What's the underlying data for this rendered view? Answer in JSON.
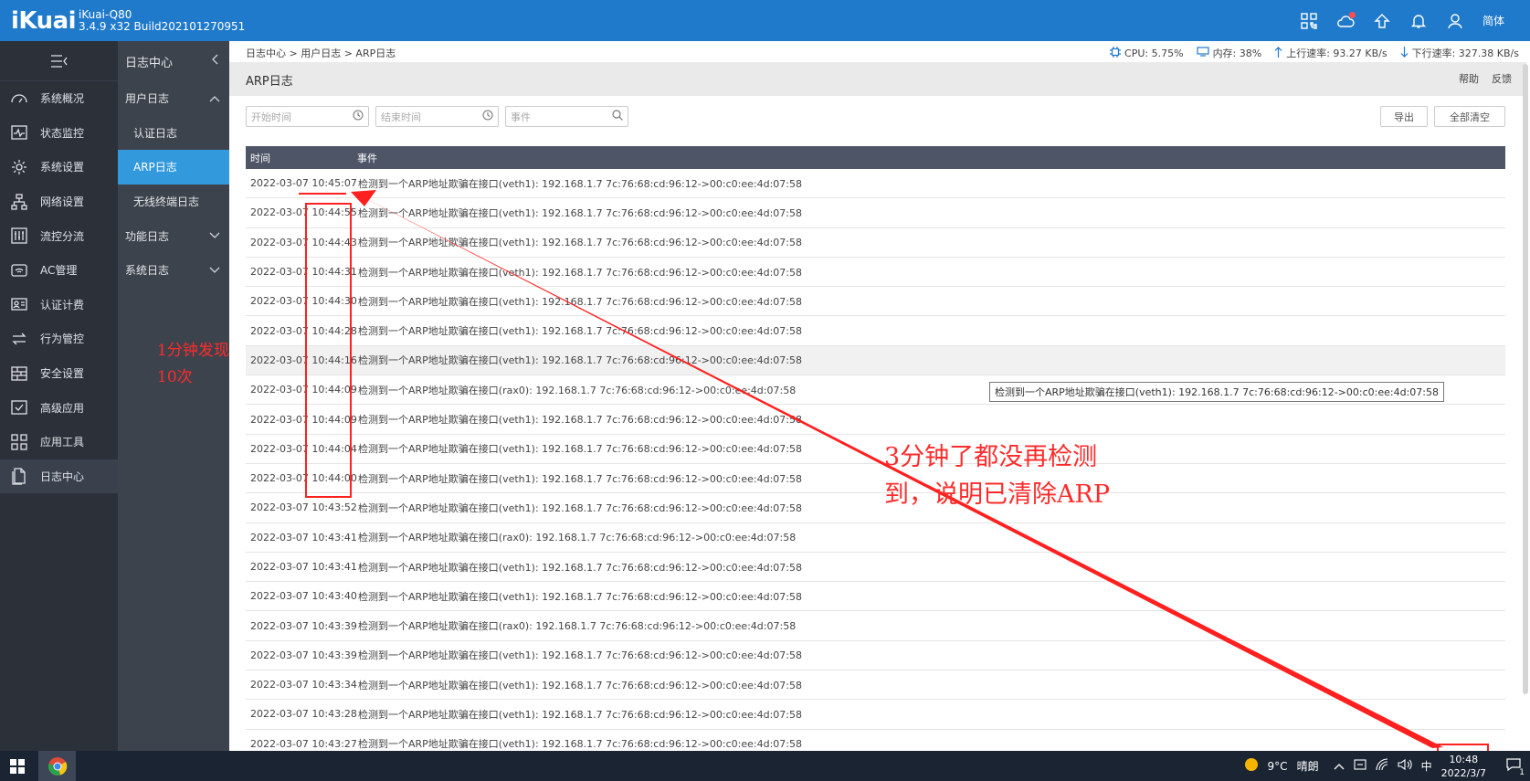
{
  "header": {
    "logo": "iKuai",
    "model": "iKuai-Q80",
    "build": "3.4.9 x32 Build202101270951",
    "lang": "简体"
  },
  "sidebar": {
    "items": [
      {
        "label": "系统概况",
        "icon": "dashboard-icon"
      },
      {
        "label": "状态监控",
        "icon": "monitor-icon"
      },
      {
        "label": "系统设置",
        "icon": "gear-icon"
      },
      {
        "label": "网络设置",
        "icon": "network-icon"
      },
      {
        "label": "流控分流",
        "icon": "sliders-icon"
      },
      {
        "label": "AC管理",
        "icon": "wifi-icon"
      },
      {
        "label": "认证计费",
        "icon": "id-card-icon"
      },
      {
        "label": "行为管控",
        "icon": "arrows-icon"
      },
      {
        "label": "安全设置",
        "icon": "firewall-icon"
      },
      {
        "label": "高级应用",
        "icon": "check-box-icon"
      },
      {
        "label": "应用工具",
        "icon": "apps-icon"
      },
      {
        "label": "日志中心",
        "icon": "document-icon"
      }
    ]
  },
  "subnav": {
    "title": "日志中心",
    "items": [
      {
        "label": "用户日志"
      },
      {
        "label": "认证日志"
      },
      {
        "label": "ARP日志"
      },
      {
        "label": "无线终端日志"
      },
      {
        "label": "功能日志"
      },
      {
        "label": "系统日志"
      }
    ]
  },
  "breadcrumb": "日志中心 > 用户日志 > ARP日志",
  "stats": {
    "cpu": "CPU: 5.75%",
    "mem": "内存: 38%",
    "up": "上行速率: 93.27 KB/s",
    "down": "下行速率: 327.38 KB/s"
  },
  "page": {
    "title": "ARP日志",
    "help": "帮助",
    "feedback": "反馈"
  },
  "filters": {
    "start_placeholder": "开始时间",
    "end_placeholder": "结束时间",
    "event_placeholder": "事件",
    "export": "导出",
    "clear_all": "全部清空"
  },
  "table": {
    "col_time": "时间",
    "col_event": "事件",
    "rows": [
      {
        "time": "2022-03-07 10:45:07",
        "event": "检测到一个ARP地址欺骗在接口(veth1): 192.168.1.7 7c:76:68:cd:96:12->00:c0:ee:4d:07:58"
      },
      {
        "time": "2022-03-07 10:44:55",
        "event": "检测到一个ARP地址欺骗在接口(veth1): 192.168.1.7 7c:76:68:cd:96:12->00:c0:ee:4d:07:58"
      },
      {
        "time": "2022-03-07 10:44:43",
        "event": "检测到一个ARP地址欺骗在接口(veth1): 192.168.1.7 7c:76:68:cd:96:12->00:c0:ee:4d:07:58"
      },
      {
        "time": "2022-03-07 10:44:31",
        "event": "检测到一个ARP地址欺骗在接口(veth1): 192.168.1.7 7c:76:68:cd:96:12->00:c0:ee:4d:07:58"
      },
      {
        "time": "2022-03-07 10:44:30",
        "event": "检测到一个ARP地址欺骗在接口(veth1): 192.168.1.7 7c:76:68:cd:96:12->00:c0:ee:4d:07:58"
      },
      {
        "time": "2022-03-07 10:44:28",
        "event": "检测到一个ARP地址欺骗在接口(veth1): 192.168.1.7 7c:76:68:cd:96:12->00:c0:ee:4d:07:58"
      },
      {
        "time": "2022-03-07 10:44:16",
        "event": "检测到一个ARP地址欺骗在接口(veth1): 192.168.1.7 7c:76:68:cd:96:12->00:c0:ee:4d:07:58"
      },
      {
        "time": "2022-03-07 10:44:09",
        "event": "检测到一个ARP地址欺骗在接口(rax0): 192.168.1.7 7c:76:68:cd:96:12->00:c0:ee:4d:07:58"
      },
      {
        "time": "2022-03-07 10:44:09",
        "event": "检测到一个ARP地址欺骗在接口(veth1): 192.168.1.7 7c:76:68:cd:96:12->00:c0:ee:4d:07:58"
      },
      {
        "time": "2022-03-07 10:44:04",
        "event": "检测到一个ARP地址欺骗在接口(veth1): 192.168.1.7 7c:76:68:cd:96:12->00:c0:ee:4d:07:58"
      },
      {
        "time": "2022-03-07 10:44:00",
        "event": "检测到一个ARP地址欺骗在接口(veth1): 192.168.1.7 7c:76:68:cd:96:12->00:c0:ee:4d:07:58"
      },
      {
        "time": "2022-03-07 10:43:52",
        "event": "检测到一个ARP地址欺骗在接口(veth1): 192.168.1.7 7c:76:68:cd:96:12->00:c0:ee:4d:07:58"
      },
      {
        "time": "2022-03-07 10:43:41",
        "event": "检测到一个ARP地址欺骗在接口(rax0): 192.168.1.7 7c:76:68:cd:96:12->00:c0:ee:4d:07:58"
      },
      {
        "time": "2022-03-07 10:43:41",
        "event": "检测到一个ARP地址欺骗在接口(veth1): 192.168.1.7 7c:76:68:cd:96:12->00:c0:ee:4d:07:58"
      },
      {
        "time": "2022-03-07 10:43:40",
        "event": "检测到一个ARP地址欺骗在接口(veth1): 192.168.1.7 7c:76:68:cd:96:12->00:c0:ee:4d:07:58"
      },
      {
        "time": "2022-03-07 10:43:39",
        "event": "检测到一个ARP地址欺骗在接口(rax0): 192.168.1.7 7c:76:68:cd:96:12->00:c0:ee:4d:07:58"
      },
      {
        "time": "2022-03-07 10:43:39",
        "event": "检测到一个ARP地址欺骗在接口(veth1): 192.168.1.7 7c:76:68:cd:96:12->00:c0:ee:4d:07:58"
      },
      {
        "time": "2022-03-07 10:43:34",
        "event": "检测到一个ARP地址欺骗在接口(veth1): 192.168.1.7 7c:76:68:cd:96:12->00:c0:ee:4d:07:58"
      },
      {
        "time": "2022-03-07 10:43:28",
        "event": "检测到一个ARP地址欺骗在接口(veth1): 192.168.1.7 7c:76:68:cd:96:12->00:c0:ee:4d:07:58"
      },
      {
        "time": "2022-03-07 10:43:27",
        "event": "检测到一个ARP地址欺骗在接口(veth1): 192.168.1.7 7c:76:68:cd:96:12->00:c0:ee:4d:07:58"
      }
    ]
  },
  "tooltip": "检测到一个ARP地址欺骗在接口(veth1): 192.168.1.7 7c:76:68:cd:96:12->00:c0:ee:4d:07:58",
  "annotations": {
    "left_line1": "1分钟发现",
    "left_line2": "10次",
    "right_line1": "3分钟了都没再检测",
    "right_line2": "到，说明已清除ARP"
  },
  "taskbar": {
    "temp": "9°C",
    "weather": "晴朗",
    "ime": "中",
    "time": "10:48",
    "date": "2022/3/7",
    "notif": "1"
  },
  "colors": {
    "header_blue": "#1f7acb",
    "sidebar_dark": "#2b3039",
    "active_blue": "#3399dd",
    "annotation_red": "#ff2b2b"
  }
}
